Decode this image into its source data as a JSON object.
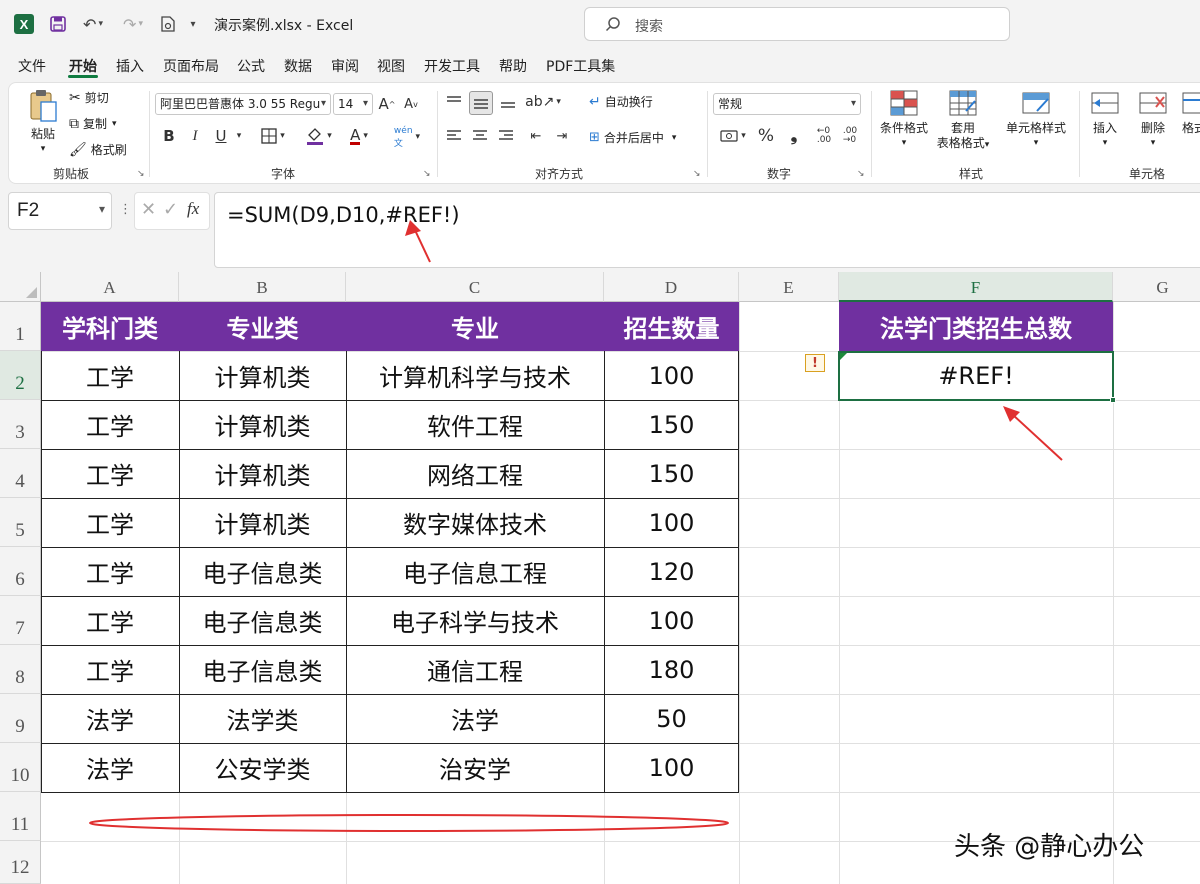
{
  "titlebar": {
    "file_name": "演示案例.xlsx",
    "separator": " - ",
    "app_name": "Excel",
    "search_placeholder": "搜索"
  },
  "menu": {
    "tabs": [
      "文件",
      "开始",
      "插入",
      "页面布局",
      "公式",
      "数据",
      "审阅",
      "视图",
      "开发工具",
      "帮助",
      "PDF工具集"
    ],
    "active_index": 1
  },
  "ribbon": {
    "clipboard": {
      "label": "剪贴板",
      "paste": "粘贴",
      "cut": "剪切",
      "copy": "复制",
      "format_painter": "格式刷"
    },
    "font": {
      "label": "字体",
      "font_name": "阿里巴巴普惠体 3.0 55 Regu",
      "font_size": "14",
      "bold": "B",
      "italic": "I",
      "underline": "U"
    },
    "alignment": {
      "label": "对齐方式",
      "wrap_text": "自动换行",
      "merge_center": "合并后居中"
    },
    "number": {
      "label": "数字",
      "format": "常规"
    },
    "styles": {
      "label": "样式",
      "conditional": "条件格式",
      "table_format_1": "套用",
      "table_format_2": "表格格式",
      "cell_styles": "单元格样式"
    },
    "cells": {
      "label": "单元格",
      "insert": "插入",
      "delete": "删除",
      "format": "格式"
    }
  },
  "formula_bar": {
    "name_box": "F2",
    "fx": "fx",
    "formula": "=SUM(D9,D10,#REF!)"
  },
  "sheet": {
    "columns": [
      "A",
      "B",
      "C",
      "D",
      "E",
      "F",
      "G"
    ],
    "rows": [
      "1",
      "2",
      "3",
      "4",
      "5",
      "6",
      "7",
      "8",
      "9",
      "10",
      "11",
      "12"
    ],
    "table_headers": [
      "学科门类",
      "专业类",
      "专业",
      "招生数量"
    ],
    "table_rows": [
      [
        "工学",
        "计算机类",
        "计算机科学与技术",
        "100"
      ],
      [
        "工学",
        "计算机类",
        "软件工程",
        "150"
      ],
      [
        "工学",
        "计算机类",
        "网络工程",
        "150"
      ],
      [
        "工学",
        "计算机类",
        "数字媒体技术",
        "100"
      ],
      [
        "工学",
        "电子信息类",
        "电子信息工程",
        "120"
      ],
      [
        "工学",
        "电子信息类",
        "电子科学与技术",
        "100"
      ],
      [
        "工学",
        "电子信息类",
        "通信工程",
        "180"
      ],
      [
        "法学",
        "法学类",
        "法学",
        "50"
      ],
      [
        "法学",
        "公安学类",
        "治安学",
        "100"
      ]
    ],
    "f_header": "法学门类招生总数",
    "f_value": "#REF!",
    "selected_cell": "F2"
  },
  "watermark": "头条 @静心办公",
  "colors": {
    "header_fill": "#7030a0",
    "accent_green": "#1d6f42",
    "annotation_red": "#e03030"
  }
}
